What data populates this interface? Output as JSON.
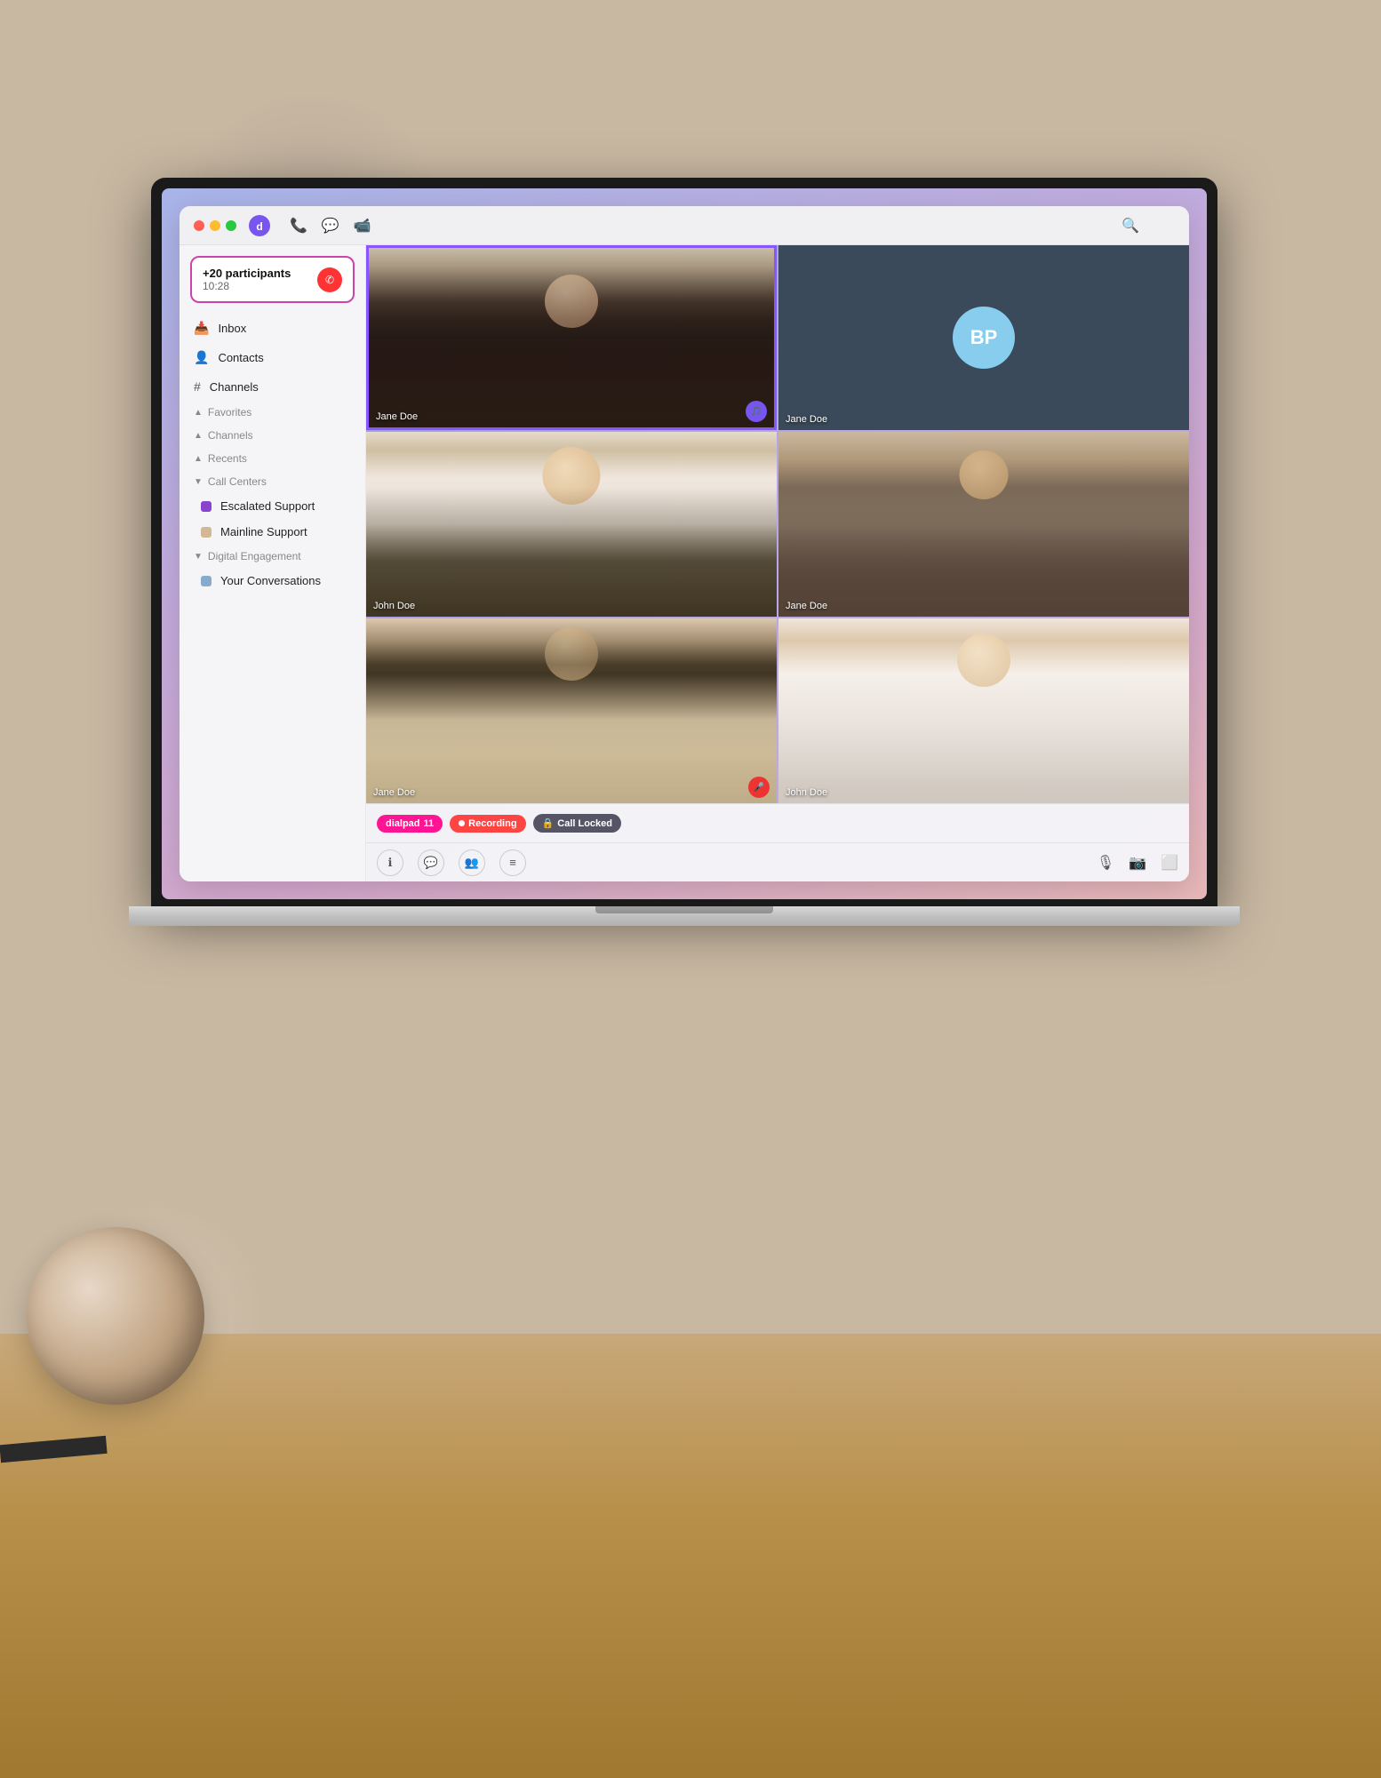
{
  "background": {
    "color": "#c8b8a2"
  },
  "titleBar": {
    "trafficLights": [
      "red",
      "yellow",
      "green"
    ],
    "icons": [
      "phone",
      "chat",
      "video"
    ],
    "searchPlaceholder": "Search"
  },
  "sidebar": {
    "activeCall": {
      "participants": "+20 participants",
      "timer": "10:28",
      "hangupIcon": "phone-hangup"
    },
    "navItems": [
      {
        "id": "inbox",
        "label": "Inbox",
        "icon": "inbox"
      },
      {
        "id": "contacts",
        "label": "Contacts",
        "icon": "contacts"
      },
      {
        "id": "channels",
        "label": "Channels",
        "icon": "hash"
      }
    ],
    "collapsibleSections": [
      {
        "id": "favorites",
        "label": "Favorites",
        "expanded": false
      },
      {
        "id": "channels",
        "label": "Channels",
        "expanded": false
      },
      {
        "id": "recents",
        "label": "Recents",
        "expanded": false
      },
      {
        "id": "call-centers",
        "label": "Call Centers",
        "expanded": true
      }
    ],
    "callCenters": [
      {
        "id": "escalated-support",
        "label": "Escalated Support",
        "color": "purple"
      },
      {
        "id": "mainline-support",
        "label": "Mainline Support",
        "color": "tan"
      }
    ],
    "digitalEngagement": {
      "label": "Digital Engagement",
      "expanded": true,
      "items": [
        {
          "id": "your-conversations",
          "label": "Your Conversations",
          "color": "blue"
        }
      ]
    }
  },
  "videoGrid": {
    "tiles": [
      {
        "id": "tile1",
        "person": "Jane Doe",
        "isActive": true,
        "hasAudio": true,
        "isMuted": false
      },
      {
        "id": "tile2",
        "person": "Jane Doe",
        "isActive": false,
        "hasAudio": false,
        "isMuted": false,
        "isAvatar": true,
        "initials": "BP"
      },
      {
        "id": "tile3",
        "person": "John Doe",
        "isActive": false,
        "hasAudio": false,
        "isMuted": false
      },
      {
        "id": "tile4",
        "person": "Jane Doe",
        "isActive": false,
        "hasAudio": false,
        "isMuted": false
      },
      {
        "id": "tile5",
        "person": "Jane Doe",
        "isActive": false,
        "hasAudio": false,
        "isMuted": true
      },
      {
        "id": "tile6",
        "person": "John Doe",
        "isActive": false,
        "hasAudio": false,
        "isMuted": false
      }
    ]
  },
  "statusBadges": [
    {
      "id": "dialpad",
      "label": "dialpad",
      "count": "11",
      "type": "dialpad"
    },
    {
      "id": "recording",
      "label": "Recording",
      "type": "recording"
    },
    {
      "id": "call-locked",
      "label": "Call Locked",
      "type": "locked"
    }
  ],
  "bottomToolbar": {
    "leftButtons": [
      {
        "id": "info",
        "icon": "ℹ",
        "label": "Info"
      },
      {
        "id": "chat",
        "icon": "💬",
        "label": "Chat"
      },
      {
        "id": "participants",
        "icon": "👥",
        "label": "Participants"
      },
      {
        "id": "settings",
        "icon": "≡",
        "label": "Settings"
      }
    ],
    "rightButtons": [
      {
        "id": "mute",
        "icon": "🎤",
        "label": "Mute"
      },
      {
        "id": "video-off",
        "icon": "📷",
        "label": "Video Off"
      },
      {
        "id": "screen-share",
        "icon": "⬜",
        "label": "Screen Share"
      }
    ]
  }
}
